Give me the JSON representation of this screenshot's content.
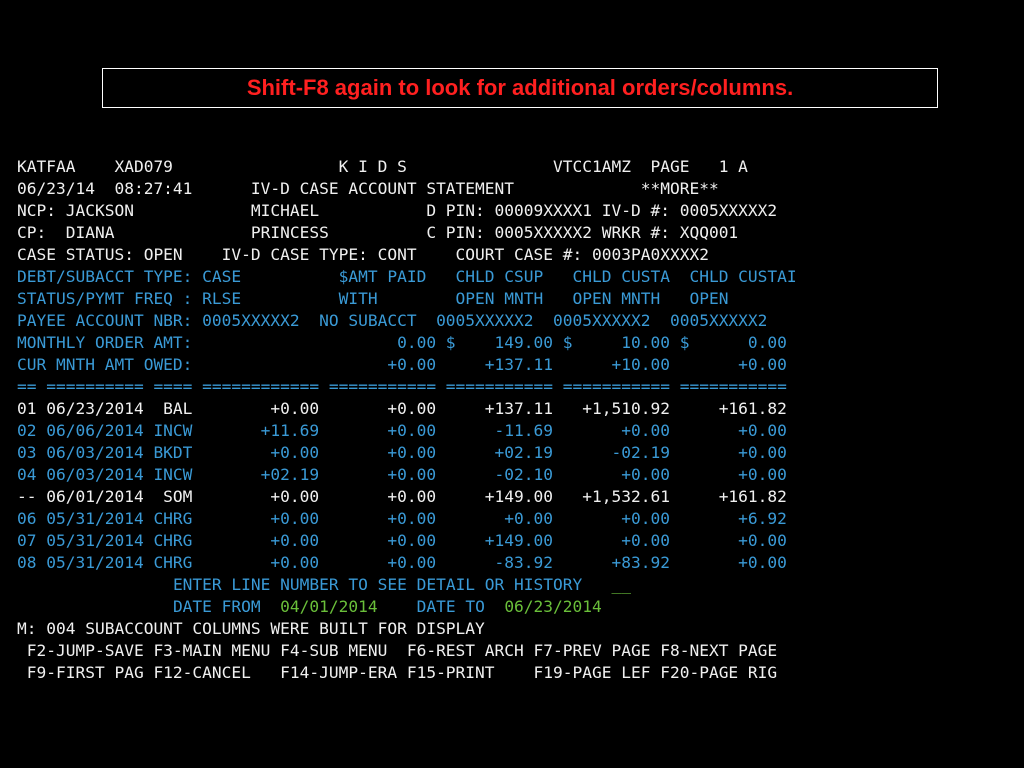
{
  "callout": {
    "text": "Shift-F8 again to look for additional orders/columns."
  },
  "colors": {
    "background": "#000000",
    "text": "#f0f0f0",
    "label_blue": "#3a9ad6",
    "value_green": "#6abf3a",
    "callout_red": "#ff2020"
  },
  "screen": {
    "lines": [
      "KATFAA    XAD079                 K I D S               VTCC1AMZ  PAGE   1 A",
      "06/23/14  08:27:41      IV-D CASE ACCOUNT STATEMENT             **MORE**",
      "NCP: JACKSON            MICHAEL           D PIN: 00009XXXX1 IV-D #: 0005XXXXX2",
      "CP:  DIANA              PRINCESS          C PIN: 0005XXXXX2 WRKR #: XQQ001",
      "CASE STATUS: OPEN    IV-D CASE TYPE: CONT    COURT CASE #: 0003PA0XXXX2",
      "DEBT/SUBACCT TYPE: CASE          $AMT PAID   CHLD CSUP   CHLD CUSTA  CHLD CUSTAI",
      "STATUS/PYMT FREQ : RLSE          WITH        OPEN MNTH   OPEN MNTH   OPEN",
      "PAYEE ACCOUNT NBR: 0005XXXXX2  NO SUBACCT  0005XXXXX2  0005XXXXX2  0005XXXXX2",
      "MONTHLY ORDER AMT:                     0.00 $    149.00 $     10.00 $      0.00",
      "CUR MNTH AMT OWED:                    +0.00     +137.11      +10.00       +0.00",
      "== ========== ==== ============ =========== =========== =========== ===========",
      "01 06/23/2014  BAL        +0.00       +0.00     +137.11   +1,510.92     +161.82",
      "02 06/06/2014 INCW       +11.69       +0.00      -11.69       +0.00       +0.00",
      "03 06/03/2014 BKDT        +0.00       +0.00      +02.19      -02.19       +0.00",
      "04 06/03/2014 INCW       +02.19       +0.00      -02.10       +0.00       +0.00",
      "-- 06/01/2014  SOM        +0.00       +0.00     +149.00   +1,532.61     +161.82",
      "06 05/31/2014 CHRG        +0.00       +0.00       +0.00       +0.00       +6.92",
      "07 05/31/2014 CHRG        +0.00       +0.00     +149.00       +0.00       +0.00",
      "08 05/31/2014 CHRG        +0.00       +0.00      -83.92      +83.92       +0.00"
    ],
    "prompt": {
      "indent": "                ",
      "label": "ENTER LINE NUMBER TO SEE DETAIL OR HISTORY   ",
      "input_value": "__"
    },
    "date_range": {
      "indent": "                ",
      "from_label": "DATE FROM  ",
      "from_value": "04/01/2014",
      "gap": "    ",
      "to_label": "DATE TO  ",
      "to_value": "06/23/2014"
    },
    "message": "M: 004 SUBACCOUNT COLUMNS WERE BUILT FOR DISPLAY",
    "fkeys_row1": " F2-JUMP-SAVE F3-MAIN MENU F4-SUB MENU  F6-REST ARCH F7-PREV PAGE F8-NEXT PAGE",
    "fkeys_row2": " F9-FIRST PAG F12-CANCEL   F14-JUMP-ERA F15-PRINT    F19-PAGE LEF F20-PAGE RIG"
  }
}
